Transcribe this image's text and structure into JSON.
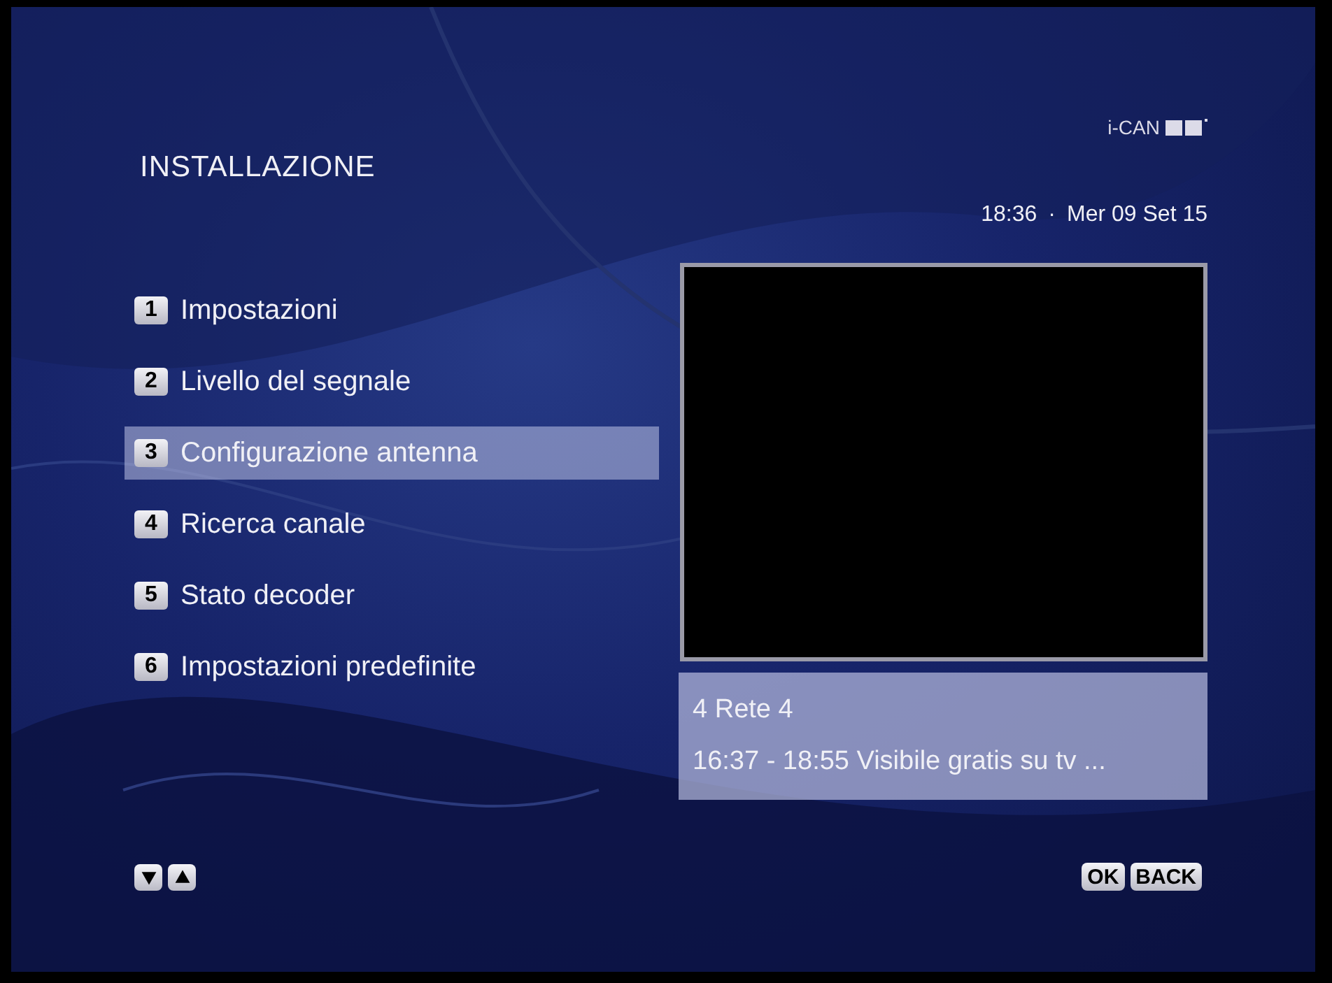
{
  "title": "INSTALLAZIONE",
  "brand": "i-CAN",
  "datetime": {
    "time": "18:36",
    "separator": "·",
    "date": "Mer 09 Set 15"
  },
  "menu": [
    {
      "number": "1",
      "label": "Impostazioni",
      "selected": false
    },
    {
      "number": "2",
      "label": "Livello del segnale",
      "selected": false
    },
    {
      "number": "3",
      "label": "Configurazione antenna",
      "selected": true
    },
    {
      "number": "4",
      "label": "Ricerca canale",
      "selected": false
    },
    {
      "number": "5",
      "label": "Stato decoder",
      "selected": false
    },
    {
      "number": "6",
      "label": "Impostazioni predefinite",
      "selected": false
    }
  ],
  "channel_info": {
    "channel": "4 Rete 4",
    "programme": "16:37 - 18:55 Visibile gratis su tv ..."
  },
  "keys": [
    "OK",
    "BACK"
  ]
}
